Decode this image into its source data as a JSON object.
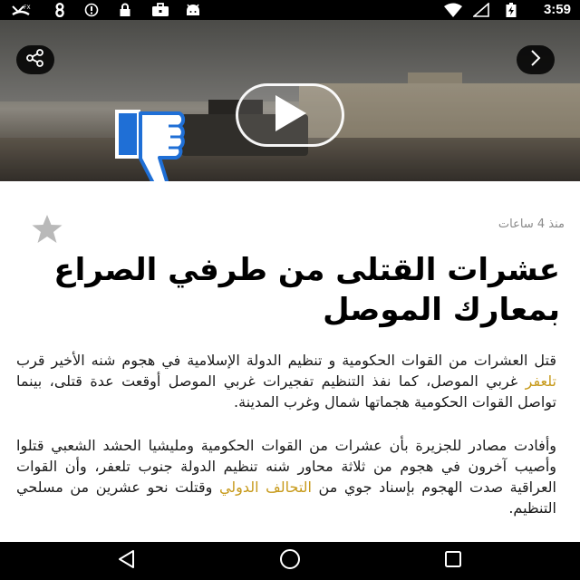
{
  "status_bar": {
    "time": "3:59",
    "icons": [
      "missed-call-icon",
      "ring-8-icon",
      "blocked-icon",
      "lock-icon",
      "briefcase-icon",
      "android-icon",
      "wifi-icon",
      "no-signal-icon",
      "battery-charging-icon"
    ]
  },
  "hero": {
    "share_icon": "share-icon",
    "next_icon": "chevron-right-icon",
    "play_icon": "play-icon",
    "overlay_icon": "thumbs-down-icon",
    "overlay_color": "#1f6fd6"
  },
  "article": {
    "timestamp": "منذ 4 ساعات",
    "headline": "عشرات القتلى من طرفي الصراع بمعارك الموصل",
    "paragraphs": [
      {
        "segments": [
          {
            "text": "قتل العشرات من القوات الحكومية و تنظيم الدولة الإسلامية في هجوم شنه الأخير قرب ",
            "link": false
          },
          {
            "text": "تلعفر",
            "link": true
          },
          {
            "text": " غربي الموصل، كما نفذ التنظيم تفجيرات غربي الموصل أوقعت عدة قتلى، بينما تواصل القوات الحكومية هجماتها شمال وغرب المدينة.",
            "link": false
          }
        ]
      },
      {
        "segments": [
          {
            "text": "وأفادت مصادر للجزيرة بأن عشرات من القوات الحكومية ومليشيا الحشد الشعبي قتلوا وأصيب آخرون في هجوم من ثلاثة محاور شنه تنظيم الدولة جنوب تلعفر، وأن القوات العراقية صدت الهجوم بإسناد جوي من ",
            "link": false
          },
          {
            "text": "التحالف الدولي",
            "link": true
          },
          {
            "text": " وقتلت نحو عشرين من مسلحي التنظيم.",
            "link": false
          }
        ]
      }
    ],
    "link_color": "#c79a1b"
  },
  "nav_bar": {
    "back_icon": "back-triangle-icon",
    "home_icon": "home-circle-icon",
    "recents_icon": "recents-square-icon"
  }
}
